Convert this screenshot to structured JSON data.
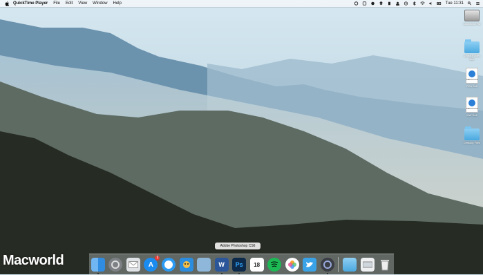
{
  "menubar": {
    "app_name": "QuickTime Player",
    "menus": [
      "File",
      "Edit",
      "View",
      "Window",
      "Help"
    ],
    "clock": "Tue 11:31"
  },
  "desktop": {
    "icons": [
      {
        "label": "Macintosh HD",
        "kind": "hard-drive"
      },
      {
        "label": "Leaks Folder files",
        "kind": "folder"
      },
      {
        "label": "PCA Soft",
        "kind": "file"
      },
      {
        "label": "MW Soft",
        "kind": "file"
      },
      {
        "label": "Desktop Files",
        "kind": "folder"
      }
    ],
    "file_ext": "MEDIA.DOC"
  },
  "watermark": "Macworld",
  "dock": {
    "tooltip": "Adobe Photoshop CS6",
    "calendar_day": "18",
    "app_store_badge": "1",
    "word_letter": "W",
    "photoshop_letters": "Ps",
    "items": [
      "finder-icon",
      "system-preferences-icon",
      "mail-icon",
      "app-store-icon",
      "safari-icon",
      "tweetbot-icon",
      "preview-icon",
      "word-icon",
      "photoshop-icon",
      "calendar-icon",
      "spotify-icon",
      "photos-icon",
      "twitter-icon",
      "quicktime-icon",
      "folder-icon",
      "downloads-icon",
      "trash-icon"
    ]
  }
}
